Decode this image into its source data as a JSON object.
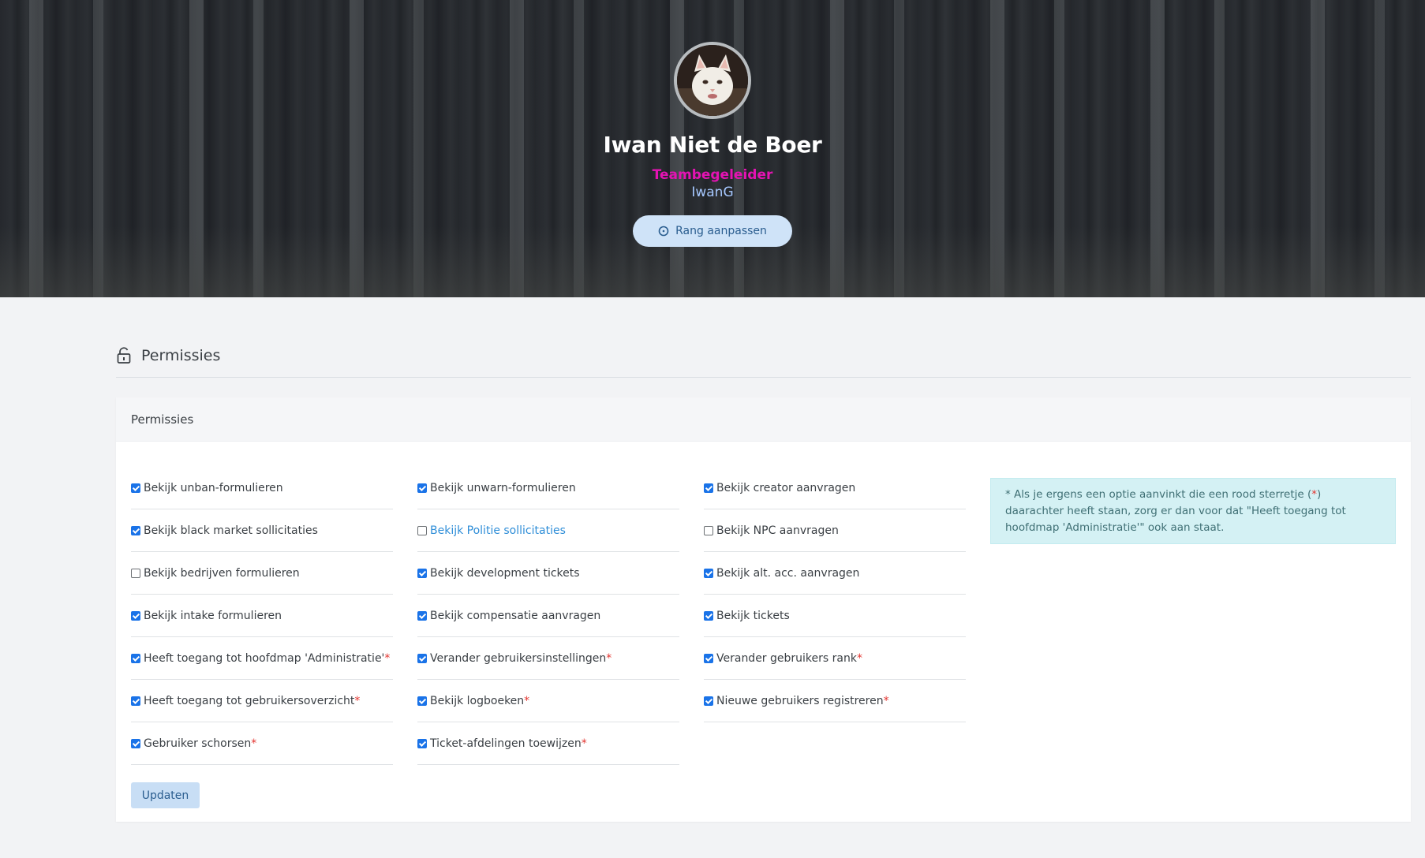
{
  "profile": {
    "name": "Iwan Niet de Boer",
    "rank": "Teambegeleider",
    "username": "IwanG",
    "rank_button": "Rang aanpassen",
    "rank_color": "#e413b3",
    "username_color": "#a6c8ff"
  },
  "section": {
    "title": "Permissies",
    "icon": "lock-open-icon"
  },
  "card": {
    "header": "Permissies",
    "update_button": "Updaten"
  },
  "permissions": {
    "col1": [
      {
        "label": "Bekijk unban-formulieren",
        "checked": true,
        "star": ""
      },
      {
        "label": "Bekijk black market sollicitaties",
        "checked": true,
        "star": ""
      },
      {
        "label": "Bekijk bedrijven formulieren",
        "checked": false,
        "star": ""
      },
      {
        "label": "Bekijk intake formulieren",
        "checked": true,
        "star": ""
      },
      {
        "label": "Heeft toegang tot hoofdmap 'Administratie'",
        "checked": true,
        "star": "*"
      },
      {
        "label": "Heeft toegang tot gebruikersoverzicht",
        "checked": true,
        "star": "*"
      },
      {
        "label": "Gebruiker schorsen",
        "checked": true,
        "star": "*"
      }
    ],
    "col2": [
      {
        "label": "Bekijk unwarn-formulieren",
        "checked": true,
        "star": ""
      },
      {
        "label": "Bekijk Politie sollicitaties",
        "checked": false,
        "star": "",
        "link": true
      },
      {
        "label": "Bekijk development tickets",
        "checked": true,
        "star": ""
      },
      {
        "label": "Bekijk compensatie aanvragen",
        "checked": true,
        "star": ""
      },
      {
        "label": "Verander gebruikersinstellingen",
        "checked": true,
        "star": "*"
      },
      {
        "label": "Bekijk logboeken",
        "checked": true,
        "star": "*"
      },
      {
        "label": "Ticket-afdelingen toewijzen",
        "checked": true,
        "star": "*"
      }
    ],
    "col3": [
      {
        "label": "Bekijk creator aanvragen",
        "checked": true,
        "star": ""
      },
      {
        "label": "Bekijk NPC aanvragen",
        "checked": false,
        "star": ""
      },
      {
        "label": "Bekijk alt. acc. aanvragen",
        "checked": true,
        "star": ""
      },
      {
        "label": "Bekijk tickets",
        "checked": true,
        "star": ""
      },
      {
        "label": "Verander gebruikers rank",
        "checked": true,
        "star": "*"
      },
      {
        "label": "Nieuwe gebruikers registreren",
        "checked": true,
        "star": "*"
      }
    ]
  },
  "info": {
    "part1": "* Als je ergens een optie aanvinkt die een rood sterretje (",
    "star": "*",
    "part2": ") daarachter heeft staan, zorg er dan voor dat \"Heeft toegang tot hoofdmap 'Administratie'\" ook aan staat."
  }
}
